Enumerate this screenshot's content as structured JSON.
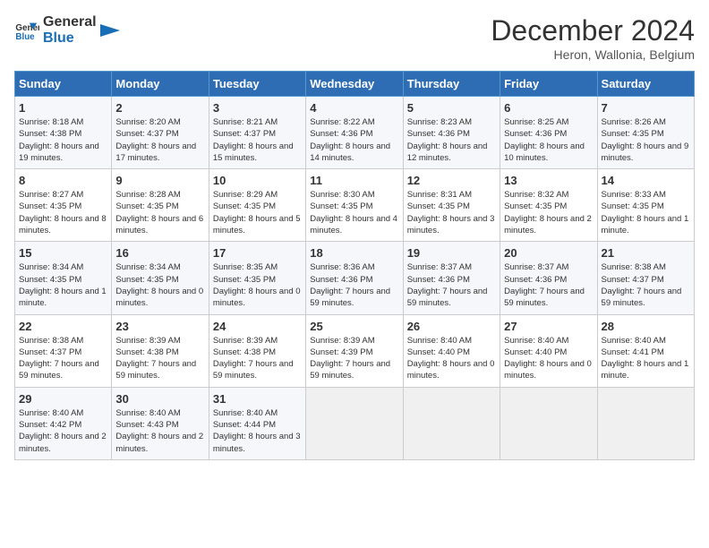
{
  "header": {
    "logo_line1": "General",
    "logo_line2": "Blue",
    "title": "December 2024",
    "subtitle": "Heron, Wallonia, Belgium"
  },
  "columns": [
    "Sunday",
    "Monday",
    "Tuesday",
    "Wednesday",
    "Thursday",
    "Friday",
    "Saturday"
  ],
  "weeks": [
    [
      {
        "day": "1",
        "sunrise": "8:18 AM",
        "sunset": "4:38 PM",
        "daylight": "8 hours and 19 minutes."
      },
      {
        "day": "2",
        "sunrise": "8:20 AM",
        "sunset": "4:37 PM",
        "daylight": "8 hours and 17 minutes."
      },
      {
        "day": "3",
        "sunrise": "8:21 AM",
        "sunset": "4:37 PM",
        "daylight": "8 hours and 15 minutes."
      },
      {
        "day": "4",
        "sunrise": "8:22 AM",
        "sunset": "4:36 PM",
        "daylight": "8 hours and 14 minutes."
      },
      {
        "day": "5",
        "sunrise": "8:23 AM",
        "sunset": "4:36 PM",
        "daylight": "8 hours and 12 minutes."
      },
      {
        "day": "6",
        "sunrise": "8:25 AM",
        "sunset": "4:36 PM",
        "daylight": "8 hours and 10 minutes."
      },
      {
        "day": "7",
        "sunrise": "8:26 AM",
        "sunset": "4:35 PM",
        "daylight": "8 hours and 9 minutes."
      }
    ],
    [
      {
        "day": "8",
        "sunrise": "8:27 AM",
        "sunset": "4:35 PM",
        "daylight": "8 hours and 8 minutes."
      },
      {
        "day": "9",
        "sunrise": "8:28 AM",
        "sunset": "4:35 PM",
        "daylight": "8 hours and 6 minutes."
      },
      {
        "day": "10",
        "sunrise": "8:29 AM",
        "sunset": "4:35 PM",
        "daylight": "8 hours and 5 minutes."
      },
      {
        "day": "11",
        "sunrise": "8:30 AM",
        "sunset": "4:35 PM",
        "daylight": "8 hours and 4 minutes."
      },
      {
        "day": "12",
        "sunrise": "8:31 AM",
        "sunset": "4:35 PM",
        "daylight": "8 hours and 3 minutes."
      },
      {
        "day": "13",
        "sunrise": "8:32 AM",
        "sunset": "4:35 PM",
        "daylight": "8 hours and 2 minutes."
      },
      {
        "day": "14",
        "sunrise": "8:33 AM",
        "sunset": "4:35 PM",
        "daylight": "8 hours and 1 minute."
      }
    ],
    [
      {
        "day": "15",
        "sunrise": "8:34 AM",
        "sunset": "4:35 PM",
        "daylight": "8 hours and 1 minute."
      },
      {
        "day": "16",
        "sunrise": "8:34 AM",
        "sunset": "4:35 PM",
        "daylight": "8 hours and 0 minutes."
      },
      {
        "day": "17",
        "sunrise": "8:35 AM",
        "sunset": "4:35 PM",
        "daylight": "8 hours and 0 minutes."
      },
      {
        "day": "18",
        "sunrise": "8:36 AM",
        "sunset": "4:36 PM",
        "daylight": "7 hours and 59 minutes."
      },
      {
        "day": "19",
        "sunrise": "8:37 AM",
        "sunset": "4:36 PM",
        "daylight": "7 hours and 59 minutes."
      },
      {
        "day": "20",
        "sunrise": "8:37 AM",
        "sunset": "4:36 PM",
        "daylight": "7 hours and 59 minutes."
      },
      {
        "day": "21",
        "sunrise": "8:38 AM",
        "sunset": "4:37 PM",
        "daylight": "7 hours and 59 minutes."
      }
    ],
    [
      {
        "day": "22",
        "sunrise": "8:38 AM",
        "sunset": "4:37 PM",
        "daylight": "7 hours and 59 minutes."
      },
      {
        "day": "23",
        "sunrise": "8:39 AM",
        "sunset": "4:38 PM",
        "daylight": "7 hours and 59 minutes."
      },
      {
        "day": "24",
        "sunrise": "8:39 AM",
        "sunset": "4:38 PM",
        "daylight": "7 hours and 59 minutes."
      },
      {
        "day": "25",
        "sunrise": "8:39 AM",
        "sunset": "4:39 PM",
        "daylight": "7 hours and 59 minutes."
      },
      {
        "day": "26",
        "sunrise": "8:40 AM",
        "sunset": "4:40 PM",
        "daylight": "8 hours and 0 minutes."
      },
      {
        "day": "27",
        "sunrise": "8:40 AM",
        "sunset": "4:40 PM",
        "daylight": "8 hours and 0 minutes."
      },
      {
        "day": "28",
        "sunrise": "8:40 AM",
        "sunset": "4:41 PM",
        "daylight": "8 hours and 1 minute."
      }
    ],
    [
      {
        "day": "29",
        "sunrise": "8:40 AM",
        "sunset": "4:42 PM",
        "daylight": "8 hours and 2 minutes."
      },
      {
        "day": "30",
        "sunrise": "8:40 AM",
        "sunset": "4:43 PM",
        "daylight": "8 hours and 2 minutes."
      },
      {
        "day": "31",
        "sunrise": "8:40 AM",
        "sunset": "4:44 PM",
        "daylight": "8 hours and 3 minutes."
      },
      null,
      null,
      null,
      null
    ]
  ],
  "labels": {
    "sunrise": "Sunrise:",
    "sunset": "Sunset:",
    "daylight": "Daylight:"
  }
}
